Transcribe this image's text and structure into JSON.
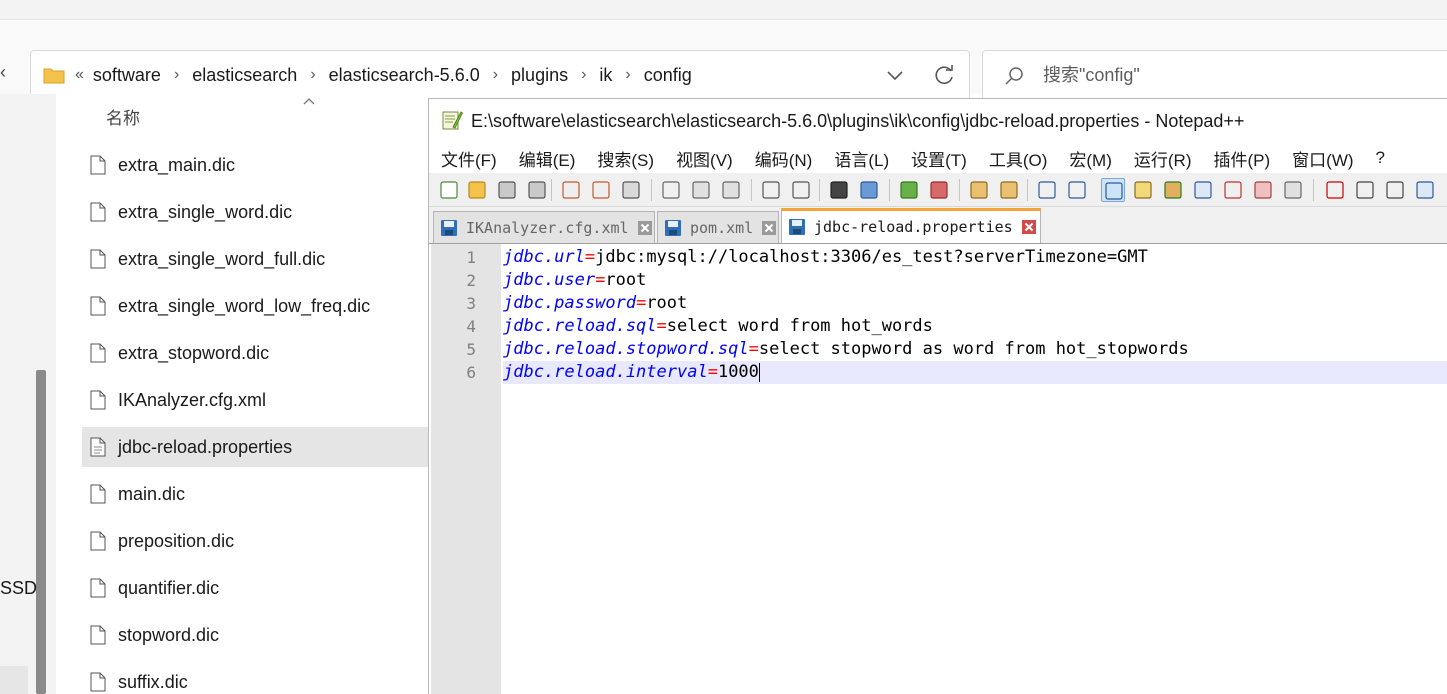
{
  "explorer": {
    "breadcrumb_lead": "«",
    "breadcrumb": [
      "software",
      "elasticsearch",
      "elasticsearch-5.6.0",
      "plugins",
      "ik",
      "config"
    ],
    "search_placeholder": "搜索\"config\"",
    "column_header": "名称",
    "nav_partial_label": "SSD",
    "files": [
      {
        "name": "extra_main.dic",
        "selected": false
      },
      {
        "name": "extra_single_word.dic",
        "selected": false
      },
      {
        "name": "extra_single_word_full.dic",
        "selected": false
      },
      {
        "name": "extra_single_word_low_freq.dic",
        "selected": false
      },
      {
        "name": "extra_stopword.dic",
        "selected": false
      },
      {
        "name": "IKAnalyzer.cfg.xml",
        "selected": false
      },
      {
        "name": "jdbc-reload.properties",
        "selected": true
      },
      {
        "name": "main.dic",
        "selected": false
      },
      {
        "name": "preposition.dic",
        "selected": false
      },
      {
        "name": "quantifier.dic",
        "selected": false
      },
      {
        "name": "stopword.dic",
        "selected": false
      },
      {
        "name": "suffix.dic",
        "selected": false
      }
    ]
  },
  "notepad": {
    "title": "E:\\software\\elasticsearch\\elasticsearch-5.6.0\\plugins\\ik\\config\\jdbc-reload.properties - Notepad++",
    "menu": [
      "文件(F)",
      "编辑(E)",
      "搜索(S)",
      "视图(V)",
      "编码(N)",
      "语言(L)",
      "设置(T)",
      "工具(O)",
      "宏(M)",
      "运行(R)",
      "插件(P)",
      "窗口(W)",
      "?"
    ],
    "tabs": [
      {
        "label": "IKAnalyzer.cfg.xml",
        "active": false
      },
      {
        "label": "pom.xml",
        "active": false
      },
      {
        "label": "jdbc-reload.properties",
        "active": true
      }
    ],
    "lines": [
      {
        "num": "1",
        "key": "jdbc.url",
        "eq": "=",
        "value": "jdbc:mysql://localhost:3306/es_test?serverTimezone=GMT"
      },
      {
        "num": "2",
        "key": "jdbc.user",
        "eq": "=",
        "value": "root"
      },
      {
        "num": "3",
        "key": "jdbc.password",
        "eq": "=",
        "value": "root"
      },
      {
        "num": "4",
        "key": "jdbc.reload.sql",
        "eq": "=",
        "value": "select word from hot_words"
      },
      {
        "num": "5",
        "key": "jdbc.reload.stopword.sql",
        "eq": "=",
        "value": "select stopword as word from hot_stopwords"
      },
      {
        "num": "6",
        "key": "jdbc.reload.interval",
        "eq": "=",
        "value": "1000"
      }
    ],
    "colors": {
      "key": "#0000ff",
      "operator": "#ff0000",
      "value": "#000000",
      "current_line": "#e8e8ff",
      "active_tab_accent": "#f6a23a"
    }
  }
}
